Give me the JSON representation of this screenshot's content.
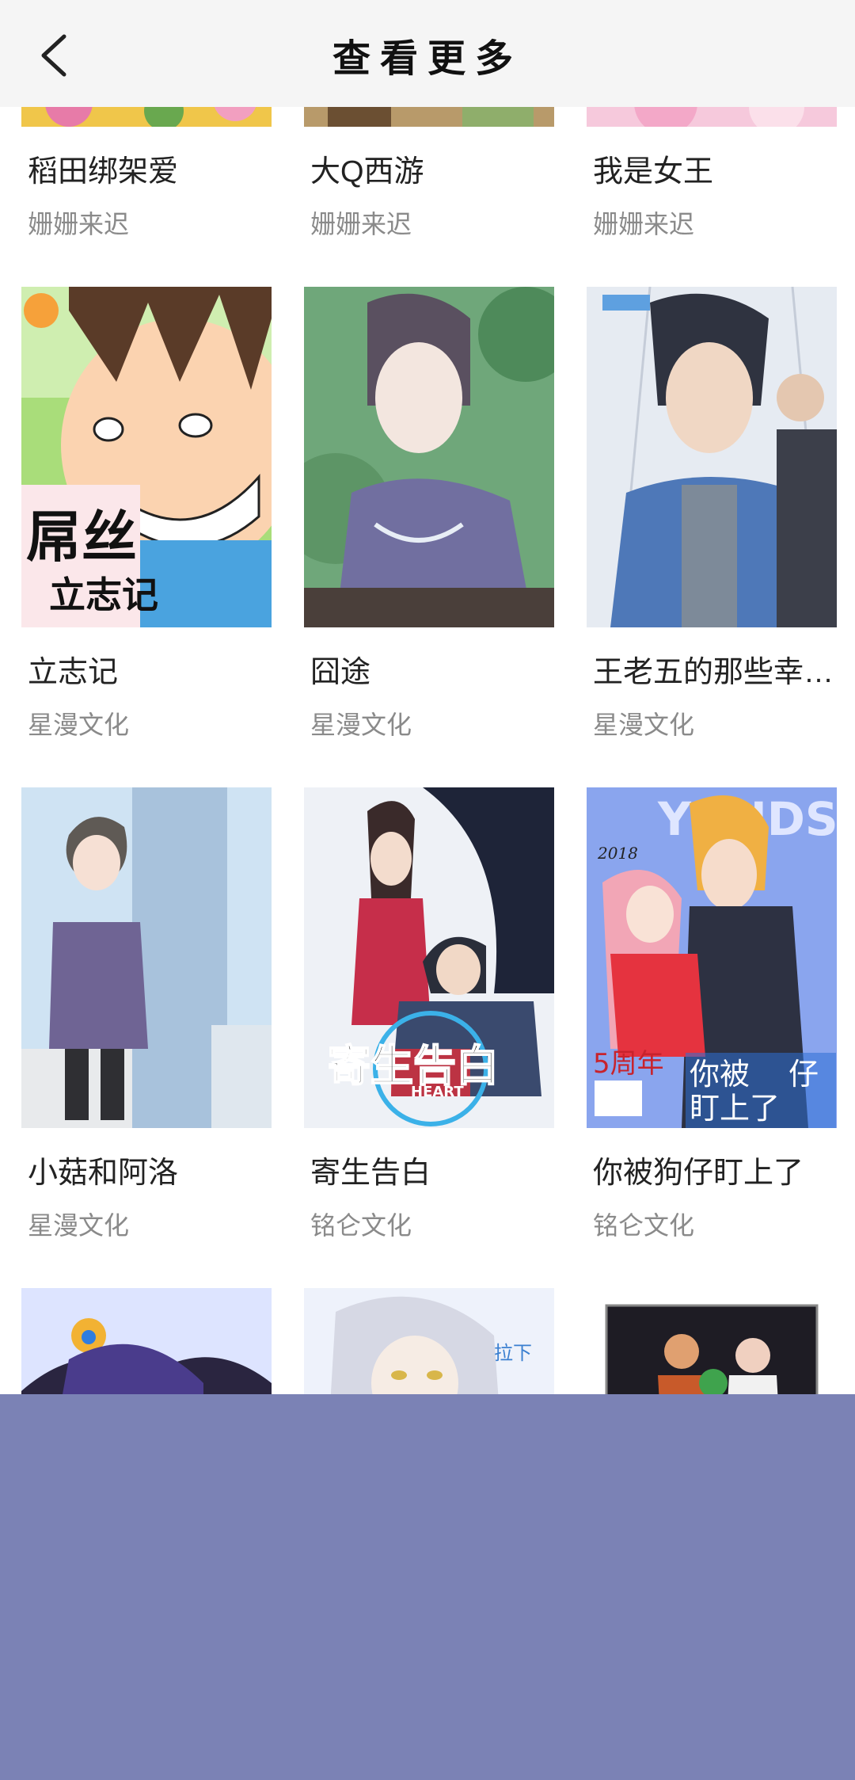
{
  "header": {
    "title": "查看更多",
    "back_icon": "chevron-left-icon"
  },
  "rows": [
    {
      "items": [
        {
          "name": "稻田绑架爱",
          "author": "姗姗来迟"
        },
        {
          "name": "大Q西游",
          "author": "姗姗来迟"
        },
        {
          "name": "我是女王",
          "author": "姗姗来迟"
        }
      ]
    },
    {
      "items": [
        {
          "name": "立志记",
          "author": "星漫文化",
          "cover_text": [
            "屌丝",
            "立志记"
          ]
        },
        {
          "name": "囧途",
          "author": "星漫文化"
        },
        {
          "name": "王老五的那些幸…",
          "author": "星漫文化"
        }
      ]
    },
    {
      "items": [
        {
          "name": "小菇和阿洛",
          "author": "星漫文化"
        },
        {
          "name": "寄生告白",
          "author": "铭仑文化",
          "cover_text": [
            "寄生告白",
            "HEART"
          ]
        },
        {
          "name": "你被狗仔盯上了",
          "author": "铭仑文化",
          "cover_text": [
            "YONDS",
            "你被",
            "仔",
            "盯上了",
            "5周年",
            "2018"
          ]
        }
      ]
    },
    {
      "items": [
        {
          "name": "",
          "author": ""
        },
        {
          "name": "",
          "author": "",
          "cover_text": [
            "拉下"
          ]
        },
        {
          "name": "",
          "author": ""
        }
      ]
    }
  ],
  "colors": {
    "overlay": "#7b82b5",
    "header_bg": "#f5f5f5",
    "author_text": "#8a8a8a"
  }
}
